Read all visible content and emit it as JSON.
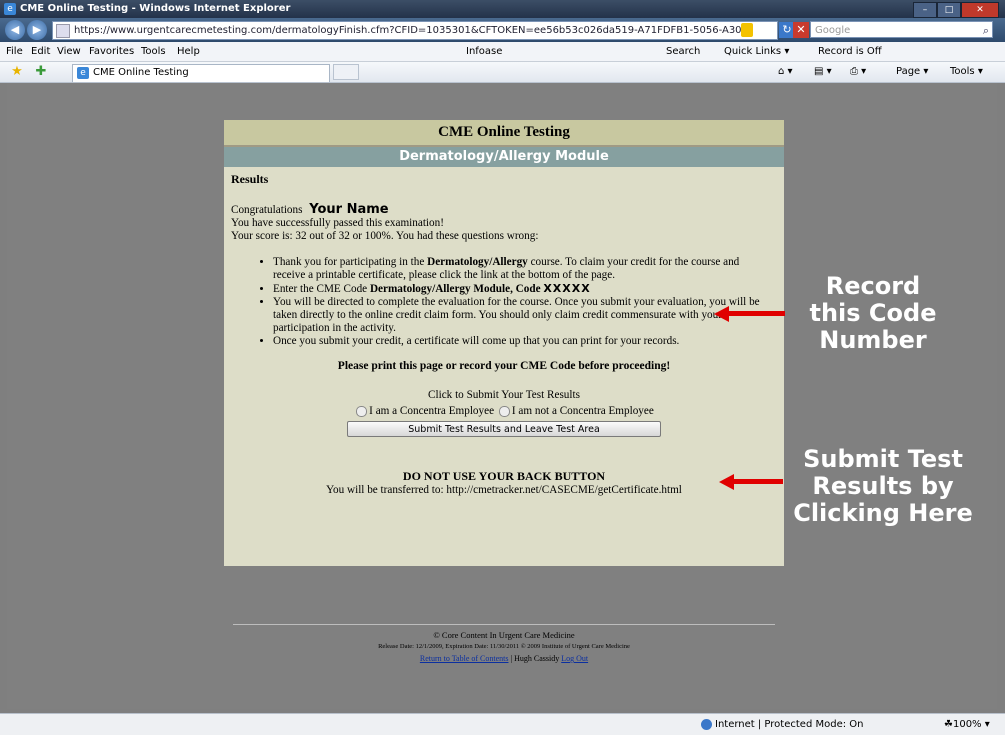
{
  "window": {
    "title": "CME Online Testing - Windows Internet Explorer",
    "minimize_glyph": "–",
    "maximize_glyph": "□",
    "close_glyph": "✕"
  },
  "address": {
    "url": "https://www.urgentcarecmetesting.com/dermatologyFinish.cfm?CFID=1035301&CFTOKEN=ee56b53c026da519-A71FDFB1-5056-A30(",
    "back_glyph": "◀",
    "forward_glyph": "▶",
    "refresh_glyph": "↻",
    "stop_glyph": "✕",
    "search_placeholder": "Google",
    "search_glyph": "⌕"
  },
  "menu": {
    "items": [
      "File",
      "Edit",
      "View",
      "Favorites",
      "Tools",
      "Help"
    ],
    "infoase": "Infoase",
    "search": "Search",
    "quick_links": "Quick Links ▾",
    "record": "Record is Off"
  },
  "tabs": {
    "active": "CME Online Testing",
    "commands": {
      "home": "⌂ ▾",
      "feeds": "▤ ▾",
      "print": "⎙ ▾",
      "page": "Page ▾",
      "tools": "Tools ▾"
    }
  },
  "card": {
    "header": "CME Online Testing",
    "module": "Dermatology/Allergy Module",
    "results_heading": "Results",
    "congrats": "Congratulations",
    "your_name": "Your Name",
    "passed": "You have successfully passed this examination!",
    "score": "Your score is: 32 out of 32 or 100%. You had these questions wrong:",
    "bullets": {
      "b1_pre": "Thank you for participating in the ",
      "b1_bold": "Dermatology/Allergy",
      "b1_post": " course. To claim your credit for the course and receive a printable certificate, please click the link at the bottom of the page.",
      "b2_pre": "Enter the CME Code ",
      "b2_bold": "Dermatology/Allergy Module, Code ",
      "b2_code": "XXXXX",
      "b3": "You will be directed to complete the evaluation for the course. Once you submit your evaluation, you will be taken directly to the online credit claim form. You should only claim credit commensurate with your participation in the activity.",
      "b4": "Once you submit your credit, a certificate will come up that you can print for your records."
    },
    "print_note": "Please print this page or record your CME Code before proceeding!",
    "click_submit": "Click to Submit Your Test Results",
    "radio_concentra": "I am a Concentra Employee",
    "radio_not_concentra": "I am not a Concentra Employee",
    "submit_button": "Submit Test Results and Leave Test Area",
    "do_not": "DO NOT USE YOUR BACK BUTTON",
    "transfer": "You will be transferred to: http://cmetracker.net/CASECME/getCertificate.html"
  },
  "footer": {
    "copyright": "© Core Content In Urgent Care Medicine",
    "release": "Release Date: 12/1/2009, Expiration Date: 11/30/2011 © 2009 Institute of Urgent Care Medicine",
    "toc_link": "Return to Table of Contents",
    "separator": " | Hugh Cassidy ",
    "logout_link": "Log Out"
  },
  "annotations": {
    "record": [
      "Record",
      "this Code",
      "Number"
    ],
    "submit": [
      "Submit Test",
      "Results by",
      "Clicking Here"
    ]
  },
  "status": {
    "zone": "Internet | Protected Mode: On",
    "zoom": "☘100%  ▾"
  }
}
